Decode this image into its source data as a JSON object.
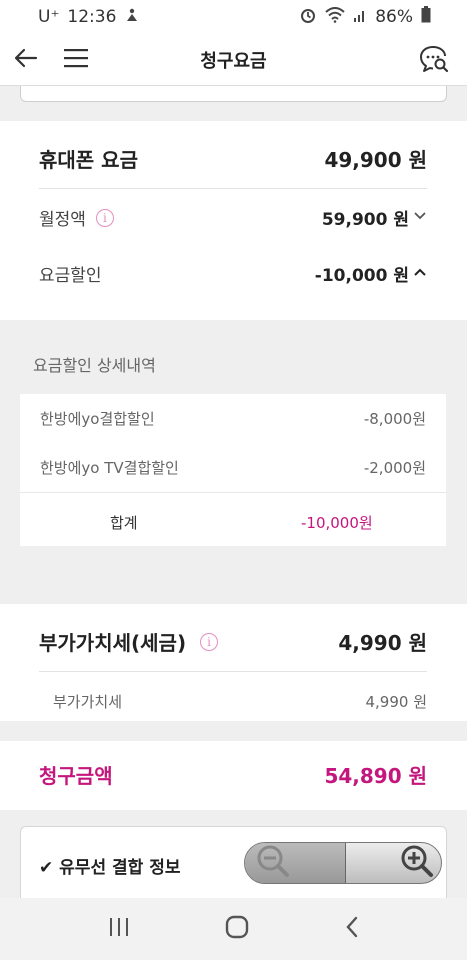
{
  "status_bar": {
    "carrier": "U⁺",
    "time": "12:36",
    "battery": "86%",
    "icons": [
      "notification-icon",
      "alarm-icon",
      "wifi-icon",
      "signal-icon",
      "battery-icon"
    ]
  },
  "app_bar": {
    "title": "청구요금",
    "icons": [
      "back-arrow-icon",
      "hamburger-menu-icon",
      "chat-search-icon"
    ]
  },
  "phone_fee": {
    "label": "휴대폰 요금",
    "value": "49,900 원",
    "monthly": {
      "label": "월정액",
      "value": "59,900 원",
      "chevron": "chevron-down-icon"
    },
    "discount": {
      "label": "요금할인",
      "value": "-10,000 원",
      "chevron": "chevron-up-icon"
    }
  },
  "discount_detail": {
    "title": "요금할인 상세내역",
    "items": [
      {
        "label": "한방에yo결합할인",
        "value": "-8,000원"
      },
      {
        "label": "한방에yo TV결합할인",
        "value": "-2,000원"
      }
    ],
    "total_label": "합계",
    "total_value": "-10,000원"
  },
  "vat": {
    "label": "부가가치세(세금)",
    "value": "4,990 원",
    "sub_label": "부가가치세",
    "sub_value": "4,990 원"
  },
  "billing": {
    "label": "청구금액",
    "value": "54,890 원"
  },
  "combination": {
    "label": "✔ 유무선 결합 정보"
  },
  "colors": {
    "accent_pink": "#c4167d",
    "info_icon_pink": "#e48ec0"
  },
  "zoom_control": {
    "icons": [
      "zoom-out-icon",
      "zoom-in-icon"
    ]
  },
  "nav_bar": {
    "icons": [
      "recent-apps-icon",
      "home-icon",
      "back-icon"
    ]
  }
}
